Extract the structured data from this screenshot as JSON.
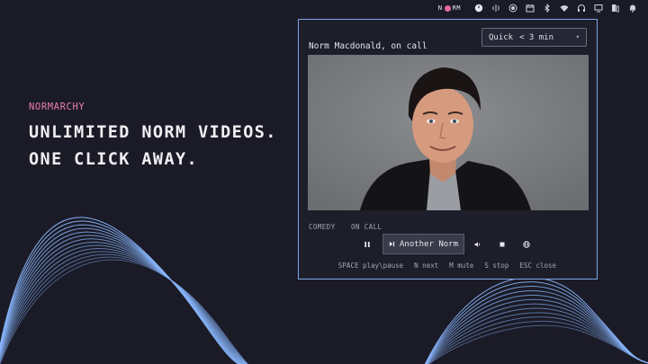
{
  "topbar": {
    "brand": "N",
    "brand_rest": "RM",
    "icons": [
      "clock-icon",
      "audio-bars-icon",
      "record-icon",
      "calendar-icon",
      "bluetooth-icon",
      "wifi-icon",
      "headphones-icon",
      "display-icon",
      "battery-icon",
      "bell-icon"
    ]
  },
  "hero": {
    "label": "NORMARCHY",
    "line1": "UNLIMITED NORM VIDEOS.",
    "line2": "ONE CLICK AWAY."
  },
  "player": {
    "title": "Norm Macdonald, on call",
    "mode": {
      "selected": "Quick",
      "range": "< 3 min"
    },
    "tags": [
      "COMEDY",
      "ON CALL"
    ],
    "next_label": "Another Norm",
    "shortcuts": [
      "SPACE play\\pause",
      "N next",
      "M mute",
      "S stop",
      "ESC close"
    ]
  },
  "colors": {
    "background": "#1b1b27",
    "accent_pink": "#ee7fae",
    "border_blue": "#7ba6e6",
    "wave_blue": "#8ab8ff"
  }
}
